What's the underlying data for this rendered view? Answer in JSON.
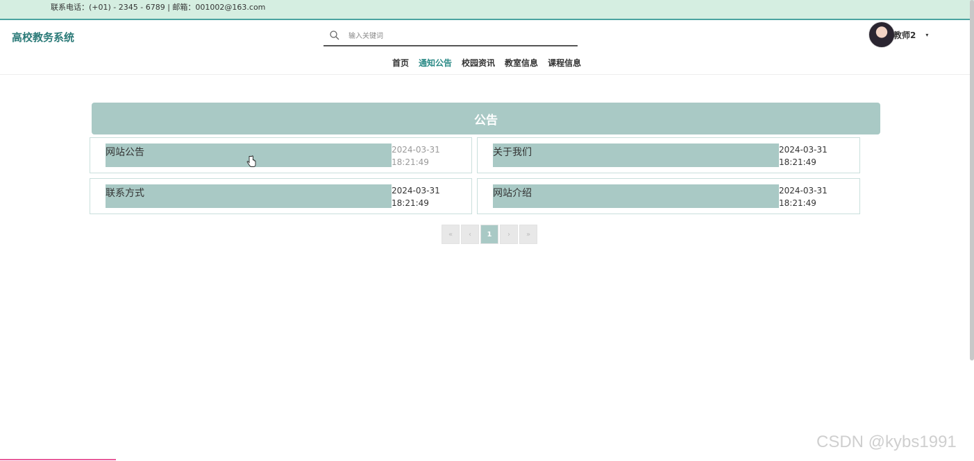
{
  "topbar": {
    "contact": "联系电话：(+01) - 2345 - 6789 | 邮箱：001002@163.com"
  },
  "header": {
    "site_title": "高校教务系统",
    "search_placeholder": "输入关键词",
    "user_name": "教师2",
    "caret": "▾"
  },
  "nav": [
    {
      "label": "首页"
    },
    {
      "label": "通知公告"
    },
    {
      "label": "校园资讯"
    },
    {
      "label": "教室信息"
    },
    {
      "label": "课程信息"
    }
  ],
  "notices": {
    "heading": "公告",
    "items": [
      {
        "title": "网站公告",
        "date": "2024-03-31",
        "time": "18:21:49"
      },
      {
        "title": "关于我们",
        "date": "2024-03-31",
        "time": "18:21:49"
      },
      {
        "title": "联系方式",
        "date": "2024-03-31",
        "time": "18:21:49"
      },
      {
        "title": "网站介绍",
        "date": "2024-03-31",
        "time": "18:21:49"
      }
    ]
  },
  "pager": {
    "first": "«",
    "prev": "‹",
    "current": "1",
    "next": "›",
    "last": "»"
  },
  "watermark": "CSDN @kybs1991",
  "colors": {
    "accent": "#2b8a86",
    "card_bar": "#a9c9c5",
    "topbar_bg": "#d5eee1"
  }
}
